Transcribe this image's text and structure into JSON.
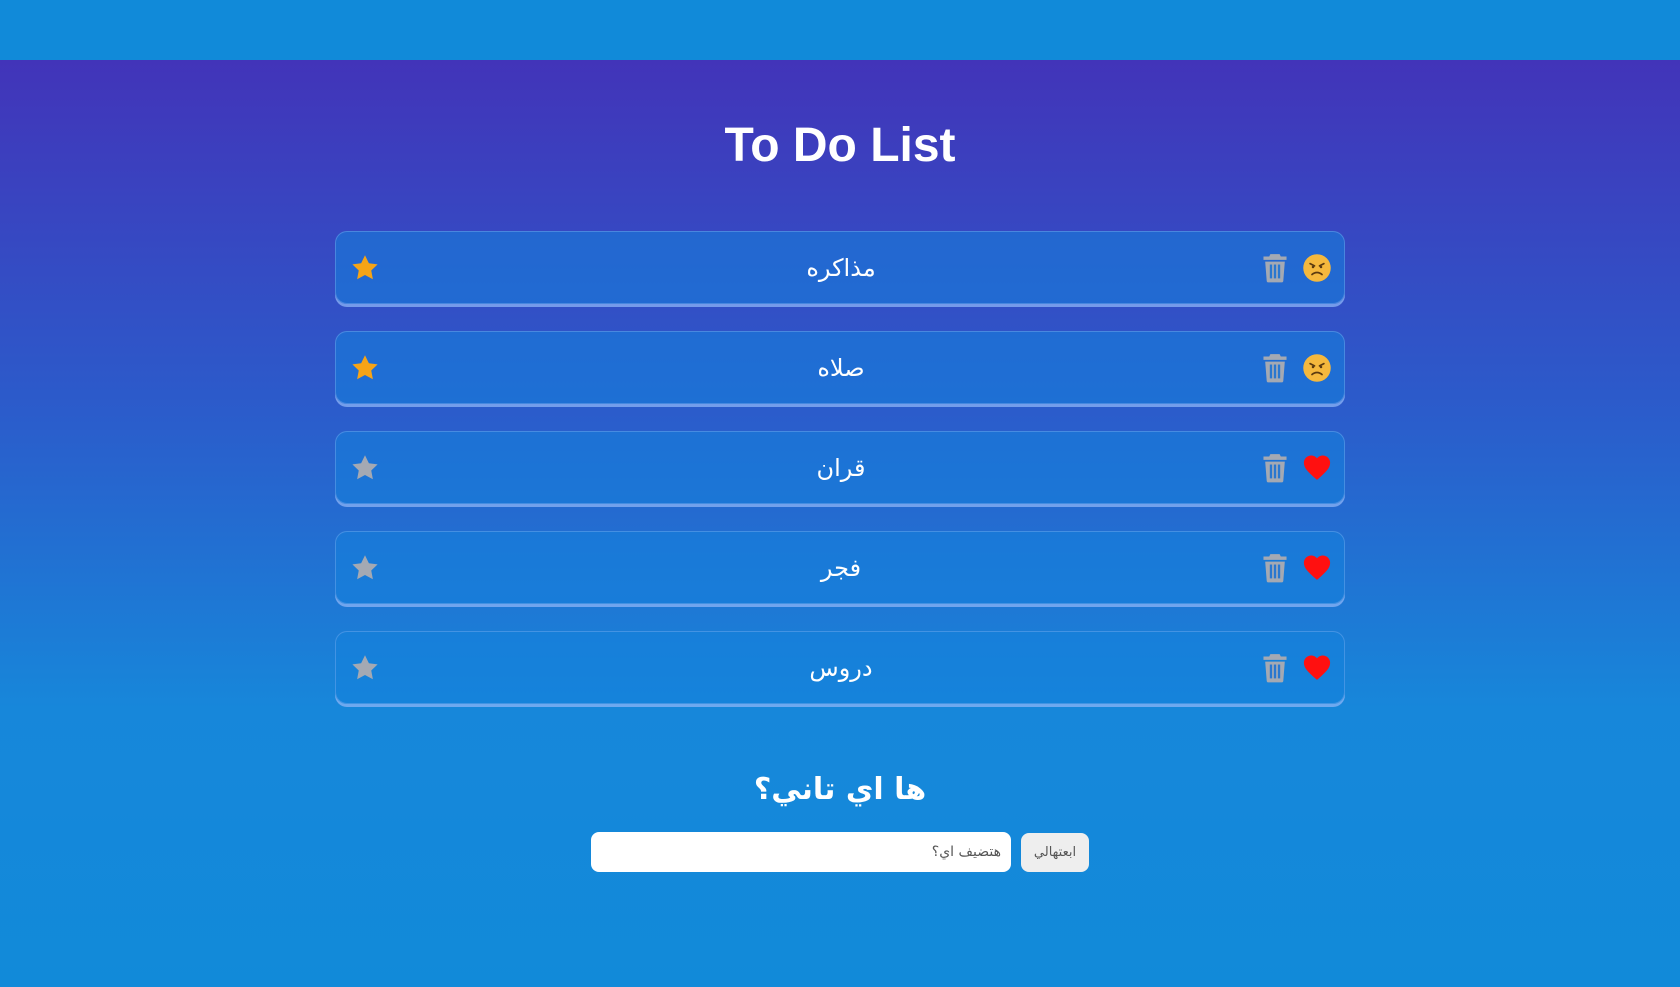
{
  "app": {
    "title": "To Do List"
  },
  "todos": [
    {
      "text": "مذاكره",
      "starred": true,
      "mood": "angry-face-icon"
    },
    {
      "text": "صلاه",
      "starred": true,
      "mood": "angry-face-icon"
    },
    {
      "text": "قران",
      "starred": false,
      "mood": "heart-icon"
    },
    {
      "text": "فجر",
      "starred": false,
      "mood": "heart-icon"
    },
    {
      "text": "دروس",
      "starred": false,
      "mood": "heart-icon"
    }
  ],
  "add_section": {
    "heading": "ها اي تاني؟",
    "input_placeholder": "هتضيف اي؟",
    "button_label": "ابعتهالي"
  },
  "colors": {
    "background_top": "#4234b9",
    "background_bottom": "#118ad9",
    "star_active": "#f6a416",
    "star_inactive": "#a4a9b3",
    "trash": "#a4a9b3",
    "heart": "#ff1010",
    "angry_face": "#f5b83d"
  }
}
